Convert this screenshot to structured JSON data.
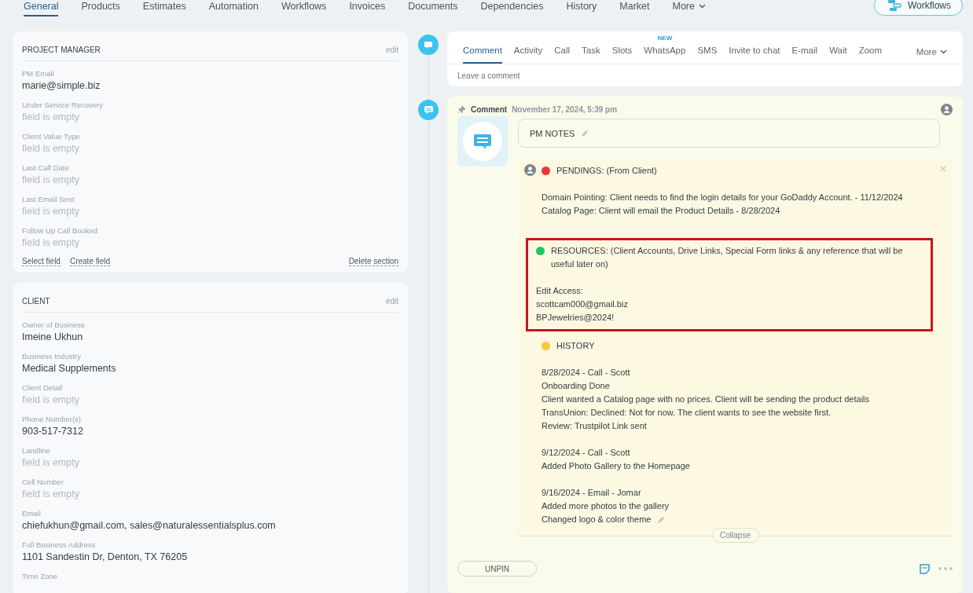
{
  "top_tabs": [
    {
      "label": "General",
      "selected": true
    },
    {
      "label": "Products",
      "selected": false
    },
    {
      "label": "Estimates",
      "selected": false
    },
    {
      "label": "Automation",
      "selected": false
    },
    {
      "label": "Workflows",
      "selected": false
    },
    {
      "label": "Invoices",
      "selected": false
    },
    {
      "label": "Documents",
      "selected": false
    },
    {
      "label": "Dependencies",
      "selected": false
    },
    {
      "label": "History",
      "selected": false
    },
    {
      "label": "Market",
      "selected": false
    },
    {
      "label": "More",
      "selected": false,
      "kind": "dropdown"
    }
  ],
  "workflows_button": "Workflows",
  "sections": [
    {
      "title": "PROJECT MANAGER",
      "edit": "edit",
      "fields": [
        {
          "label": "PM Email",
          "value": "marie@simple.biz",
          "empty": false
        },
        {
          "label": "Under Service Recovery",
          "value": "field is empty",
          "empty": true
        },
        {
          "label": "Client Value Type",
          "value": "field is empty",
          "empty": true
        },
        {
          "label": "Last Call Date",
          "value": "field is empty",
          "empty": true
        },
        {
          "label": "Last Email Sent",
          "value": "field is empty",
          "empty": true
        },
        {
          "label": "Follow Up Call Booked",
          "value": "field is empty",
          "empty": true
        }
      ],
      "actions": [
        "Select field",
        "Create field"
      ],
      "delete": "Delete section"
    },
    {
      "title": "CLIENT",
      "edit": "edit",
      "fields": [
        {
          "label": "Owner of Business",
          "value": "Imeine Ukhun",
          "empty": false
        },
        {
          "label": "Business Industry",
          "value": "Medical Supplements",
          "empty": false
        },
        {
          "label": "Client Detail",
          "value": "field is empty",
          "empty": true
        },
        {
          "label": "Phone Number(s)",
          "value": "903-517-7312",
          "empty": false
        },
        {
          "label": "Landline",
          "value": "field is empty",
          "empty": true
        },
        {
          "label": "Cell Number",
          "value": "field is empty",
          "empty": true
        },
        {
          "label": "Email",
          "value": "chiefukhun@gmail.com, sales@naturalessentialsplus.com",
          "empty": false
        },
        {
          "label": "Full Business Address",
          "value": "1101 Sandestin Dr, Denton, TX 76205",
          "empty": false
        },
        {
          "label": "Time Zone"
        }
      ]
    }
  ],
  "composer": {
    "tabs": [
      {
        "label": "Comment",
        "selected": true
      },
      {
        "label": "Activity",
        "selected": false
      },
      {
        "label": "Call",
        "selected": false
      },
      {
        "label": "Task",
        "selected": false
      },
      {
        "label": "Slots",
        "selected": false
      },
      {
        "label": "WhatsApp",
        "selected": false,
        "badge": "NEW"
      },
      {
        "label": "SMS",
        "selected": false
      },
      {
        "label": "Invite to chat",
        "selected": false
      },
      {
        "label": "E-mail",
        "selected": false
      },
      {
        "label": "Wait",
        "selected": false
      },
      {
        "label": "Zoom",
        "selected": false
      }
    ],
    "more": "More",
    "placeholder": "Leave a comment"
  },
  "comment": {
    "type": "Comment",
    "date": "November 17, 2024, 5:39 pm",
    "title": "PM NOTES",
    "note_sections": [
      {
        "color": "#e53935",
        "title": "PENDINGS: (From Client)",
        "highlighted": false,
        "blocks": [
          [
            "Domain Pointing: Client needs to find the login details for your GoDaddy Account. - 11/12/2024",
            "Catalog Page: Client will email the Product Details - 8/28/2024"
          ]
        ]
      },
      {
        "color": "#22c55e",
        "title": "RESOURCES: (Client Accounts, Drive Links, Special Form links & any reference that will be useful later on)",
        "highlighted": true,
        "blocks": [
          [
            "Edit Access:",
            "scottcam000@gmail.biz",
            "BPJewelries@2024!"
          ]
        ]
      },
      {
        "color": "#f5c842",
        "title": "HISTORY",
        "highlighted": false,
        "blocks": [
          [
            "8/28/2024 - Call - Scott",
            "Onboarding Done",
            "Client wanted a Catalog page with no prices. Client will be sending the product details",
            "TransUnion: Declined: Not for now. The client wants to see the website first.",
            "Review: Trustpilot Link sent"
          ],
          [
            "9/12/2024 - Call - Scott",
            "Added Photo Gallery to the Homepage"
          ],
          [
            "9/16/2024 - Email - Jomar",
            "Added more photos to the gallery",
            "Changed logo & color theme"
          ]
        ]
      }
    ],
    "collapse": "Collapse",
    "unpin": "UNPIN"
  }
}
